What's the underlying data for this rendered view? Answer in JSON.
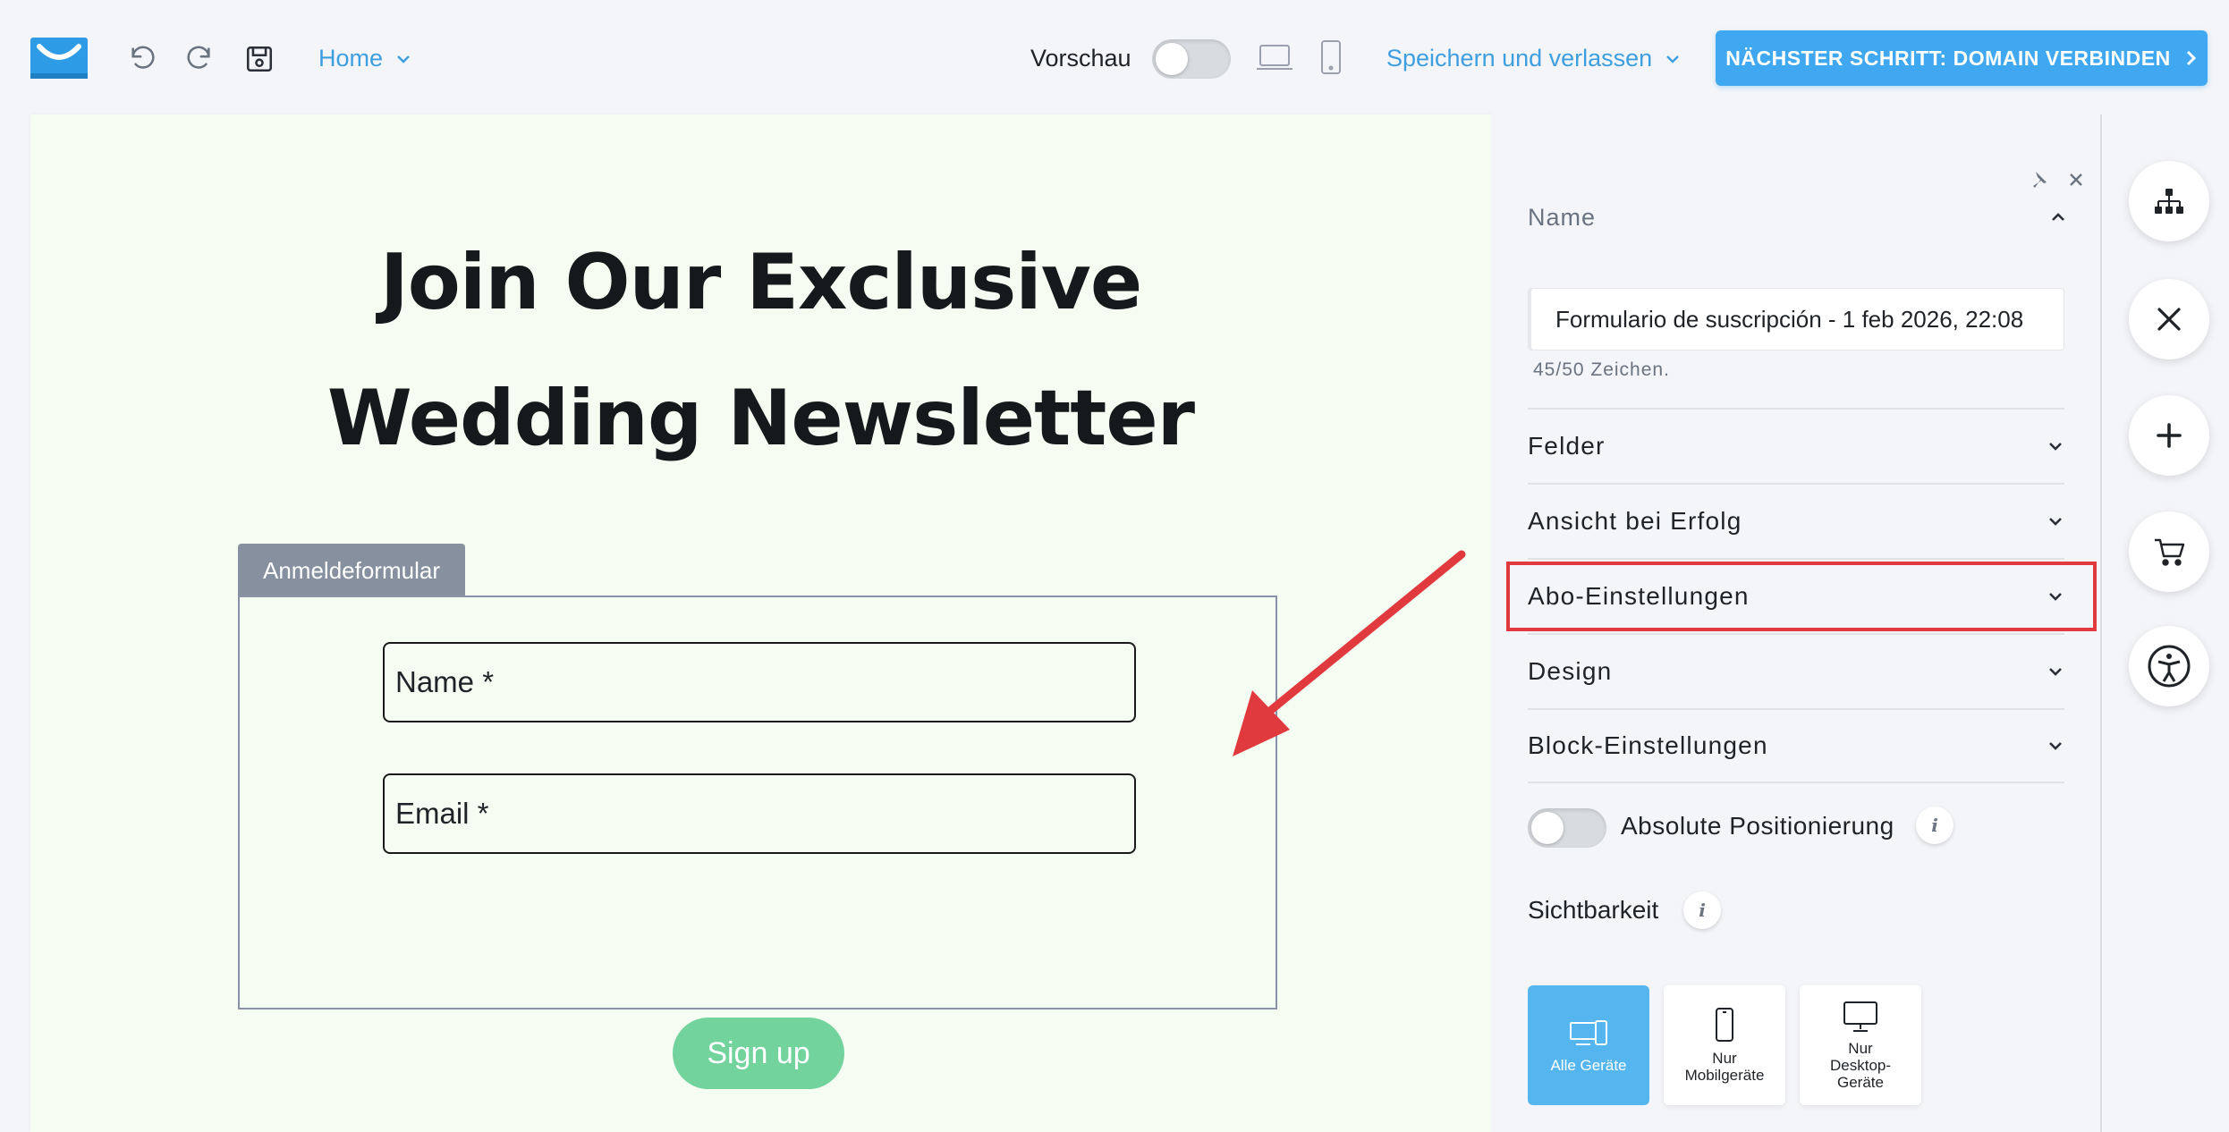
{
  "topbar": {
    "home_label": "Home",
    "preview_label": "Vorschau",
    "save_leave_label": "Speichern und verlassen",
    "next_step_label": "NÄCHSTER SCHRITT: DOMAIN VERBINDEN"
  },
  "canvas": {
    "headline_line1": "Join Our Exclusive",
    "headline_line2": "Wedding Newsletter",
    "form_tab_label": "Anmeldeformular",
    "name_field": "Name *",
    "email_field": "Email *",
    "signup_label": "Sign up"
  },
  "panel": {
    "name_section_label": "Name",
    "name_value": "Formulario de suscripción - 1 feb 2026, 22:08",
    "char_count": "45/50 Zeichen.",
    "sections": [
      "Felder",
      "Ansicht bei Erfolg",
      "Abo-Einstellungen",
      "Design",
      "Block-Einstellungen"
    ],
    "absolute_positioning_label": "Absolute Positionierung",
    "visibility_label": "Sichtbarkeit",
    "devices": [
      {
        "label": "Alle Geräte"
      },
      {
        "label": "Nur Mobilgeräte"
      },
      {
        "label": "Nur Desktop-Geräte"
      }
    ],
    "info_glyph": "i"
  },
  "colors": {
    "accent": "#3fa8f0",
    "highlight": "#e0393e",
    "signup": "#72d39c",
    "canvas_bg": "#f5fdf3"
  },
  "icons": [
    "logo-icon",
    "undo-icon",
    "redo-icon",
    "save-icon",
    "chevron-down-icon",
    "laptop-icon",
    "mobile-icon",
    "chevron-right-icon",
    "pin-icon",
    "close-icon",
    "chevron-up-icon",
    "sitemap-icon",
    "cross-tool-icon",
    "plus-icon",
    "cart-icon",
    "accessibility-icon"
  ]
}
